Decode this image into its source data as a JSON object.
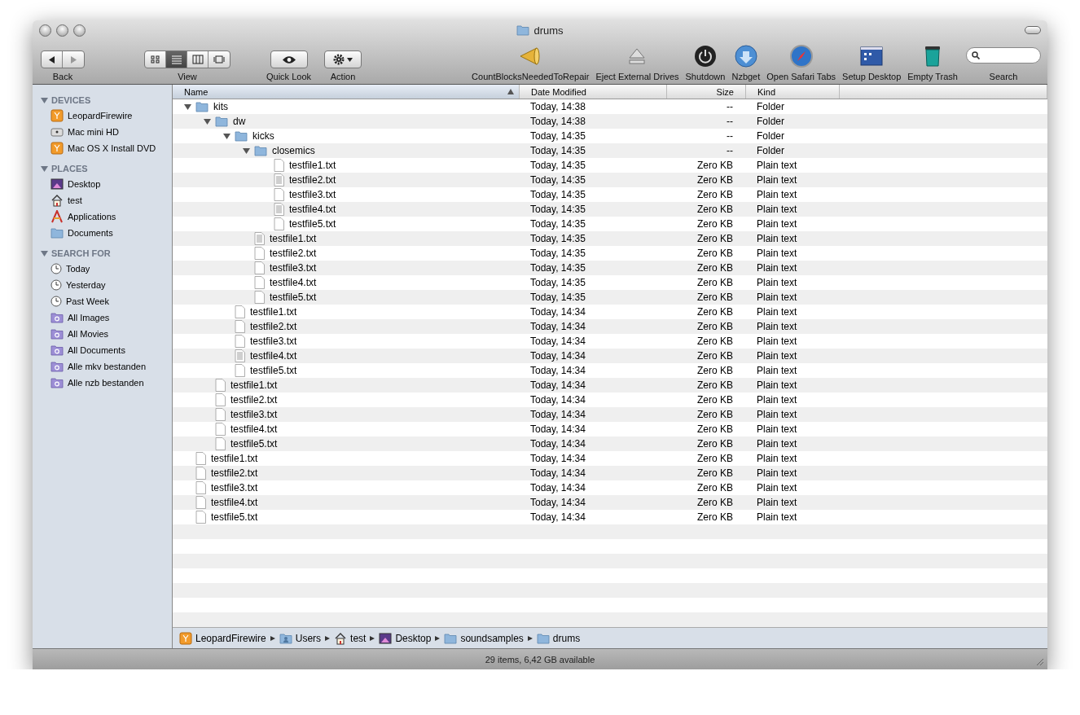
{
  "window": {
    "title": "drums"
  },
  "toolbar": {
    "items": [
      {
        "kind": "nav",
        "label": "Back"
      },
      {
        "kind": "view",
        "label": "View",
        "modes": [
          {
            "selected": false
          },
          {
            "selected": true
          },
          {
            "selected": false
          },
          {
            "selected": false
          }
        ]
      },
      {
        "kind": "quicklook",
        "label": "Quick Look"
      },
      {
        "kind": "action",
        "label": "Action"
      },
      {
        "kind": "spacer"
      },
      {
        "kind": "megaphone",
        "label": "CountBlocksNeededToRepair"
      },
      {
        "kind": "eject",
        "label": "Eject External Drives"
      },
      {
        "kind": "power",
        "label": "Shutdown"
      },
      {
        "kind": "download",
        "label": "Nzbget"
      },
      {
        "kind": "compass",
        "label": "Open Safari Tabs"
      },
      {
        "kind": "desktop",
        "label": "Setup Desktop"
      },
      {
        "kind": "trash",
        "label": "Empty Trash"
      },
      {
        "kind": "search",
        "label": "Search"
      }
    ]
  },
  "sidebar": {
    "sections": [
      {
        "title": "DEVICES",
        "expanded": true,
        "items": [
          {
            "kind": "drive",
            "label": "LeopardFirewire"
          },
          {
            "kind": "disk",
            "label": "Mac mini HD"
          },
          {
            "kind": "drive",
            "label": "Mac OS X Install DVD"
          }
        ]
      },
      {
        "title": "PLACES",
        "expanded": true,
        "items": [
          {
            "kind": "desktop",
            "label": "Desktop"
          },
          {
            "kind": "home",
            "label": "test"
          },
          {
            "kind": "apps",
            "label": "Applications"
          },
          {
            "kind": "folder",
            "label": "Documents"
          }
        ]
      },
      {
        "title": "SEARCH FOR",
        "expanded": true,
        "items": [
          {
            "kind": "clock",
            "label": "Today"
          },
          {
            "kind": "clock",
            "label": "Yesterday"
          },
          {
            "kind": "clock",
            "label": "Past Week"
          },
          {
            "kind": "smart",
            "label": "All Images"
          },
          {
            "kind": "smart",
            "label": "All Movies"
          },
          {
            "kind": "smart",
            "label": "All Documents"
          },
          {
            "kind": "smart",
            "label": "Alle mkv bestanden"
          },
          {
            "kind": "smart",
            "label": "Alle nzb bestanden"
          }
        ]
      }
    ]
  },
  "table": {
    "columns": [
      {
        "label": "Name",
        "sorted": true
      },
      {
        "label": "Date Modified",
        "sorted": false
      },
      {
        "label": "Size",
        "sorted": false
      },
      {
        "label": "Kind",
        "sorted": false
      }
    ],
    "rows": [
      {
        "kind": "folder",
        "name": "kits",
        "date": "Today, 14:38",
        "file_size": "--",
        "type_label": "Folder",
        "expanded": true,
        "children": [
          {
            "kind": "folder",
            "name": "dw",
            "date": "Today, 14:38",
            "file_size": "--",
            "type_label": "Folder",
            "expanded": true,
            "children": [
              {
                "kind": "folder",
                "name": "kicks",
                "date": "Today, 14:35",
                "file_size": "--",
                "type_label": "Folder",
                "expanded": true,
                "children": [
                  {
                    "kind": "folder",
                    "name": "closemics",
                    "date": "Today, 14:35",
                    "file_size": "--",
                    "type_label": "Folder",
                    "expanded": true,
                    "children": [
                      {
                        "kind": "file",
                        "name": "testfile1.txt",
                        "date": "Today, 14:35",
                        "file_size": "Zero KB",
                        "type_label": "Plain text"
                      },
                      {
                        "kind": "doc",
                        "name": "testfile2.txt",
                        "date": "Today, 14:35",
                        "file_size": "Zero KB",
                        "type_label": "Plain text"
                      },
                      {
                        "kind": "file",
                        "name": "testfile3.txt",
                        "date": "Today, 14:35",
                        "file_size": "Zero KB",
                        "type_label": "Plain text"
                      },
                      {
                        "kind": "doc",
                        "name": "testfile4.txt",
                        "date": "Today, 14:35",
                        "file_size": "Zero KB",
                        "type_label": "Plain text"
                      },
                      {
                        "kind": "file",
                        "name": "testfile5.txt",
                        "date": "Today, 14:35",
                        "file_size": "Zero KB",
                        "type_label": "Plain text"
                      }
                    ]
                  },
                  {
                    "kind": "doc",
                    "name": "testfile1.txt",
                    "date": "Today, 14:35",
                    "file_size": "Zero KB",
                    "type_label": "Plain text"
                  },
                  {
                    "kind": "file",
                    "name": "testfile2.txt",
                    "date": "Today, 14:35",
                    "file_size": "Zero KB",
                    "type_label": "Plain text"
                  },
                  {
                    "kind": "file",
                    "name": "testfile3.txt",
                    "date": "Today, 14:35",
                    "file_size": "Zero KB",
                    "type_label": "Plain text"
                  },
                  {
                    "kind": "file",
                    "name": "testfile4.txt",
                    "date": "Today, 14:35",
                    "file_size": "Zero KB",
                    "type_label": "Plain text"
                  },
                  {
                    "kind": "file",
                    "name": "testfile5.txt",
                    "date": "Today, 14:35",
                    "file_size": "Zero KB",
                    "type_label": "Plain text"
                  }
                ]
              },
              {
                "kind": "file",
                "name": "testfile1.txt",
                "date": "Today, 14:34",
                "file_size": "Zero KB",
                "type_label": "Plain text"
              },
              {
                "kind": "file",
                "name": "testfile2.txt",
                "date": "Today, 14:34",
                "file_size": "Zero KB",
                "type_label": "Plain text"
              },
              {
                "kind": "file",
                "name": "testfile3.txt",
                "date": "Today, 14:34",
                "file_size": "Zero KB",
                "type_label": "Plain text"
              },
              {
                "kind": "doc",
                "name": "testfile4.txt",
                "date": "Today, 14:34",
                "file_size": "Zero KB",
                "type_label": "Plain text"
              },
              {
                "kind": "file",
                "name": "testfile5.txt",
                "date": "Today, 14:34",
                "file_size": "Zero KB",
                "type_label": "Plain text"
              }
            ]
          },
          {
            "kind": "file",
            "name": "testfile1.txt",
            "date": "Today, 14:34",
            "file_size": "Zero KB",
            "type_label": "Plain text"
          },
          {
            "kind": "file",
            "name": "testfile2.txt",
            "date": "Today, 14:34",
            "file_size": "Zero KB",
            "type_label": "Plain text"
          },
          {
            "kind": "file",
            "name": "testfile3.txt",
            "date": "Today, 14:34",
            "file_size": "Zero KB",
            "type_label": "Plain text"
          },
          {
            "kind": "file",
            "name": "testfile4.txt",
            "date": "Today, 14:34",
            "file_size": "Zero KB",
            "type_label": "Plain text"
          },
          {
            "kind": "file",
            "name": "testfile5.txt",
            "date": "Today, 14:34",
            "file_size": "Zero KB",
            "type_label": "Plain text"
          }
        ]
      },
      {
        "kind": "file",
        "name": "testfile1.txt",
        "date": "Today, 14:34",
        "file_size": "Zero KB",
        "type_label": "Plain text"
      },
      {
        "kind": "file",
        "name": "testfile2.txt",
        "date": "Today, 14:34",
        "file_size": "Zero KB",
        "type_label": "Plain text"
      },
      {
        "kind": "file",
        "name": "testfile3.txt",
        "date": "Today, 14:34",
        "file_size": "Zero KB",
        "type_label": "Plain text"
      },
      {
        "kind": "file",
        "name": "testfile4.txt",
        "date": "Today, 14:34",
        "file_size": "Zero KB",
        "type_label": "Plain text"
      },
      {
        "kind": "file",
        "name": "testfile5.txt",
        "date": "Today, 14:34",
        "file_size": "Zero KB",
        "type_label": "Plain text"
      }
    ]
  },
  "path_bar": [
    {
      "kind": "drive",
      "label": "LeopardFirewire"
    },
    {
      "kind": "users",
      "label": "Users"
    },
    {
      "kind": "home",
      "label": "test"
    },
    {
      "kind": "desktop",
      "label": "Desktop"
    },
    {
      "kind": "folder",
      "label": "soundsamples"
    },
    {
      "kind": "folder",
      "label": "drums"
    }
  ],
  "status_bar": "29 items, 6,42 GB available"
}
